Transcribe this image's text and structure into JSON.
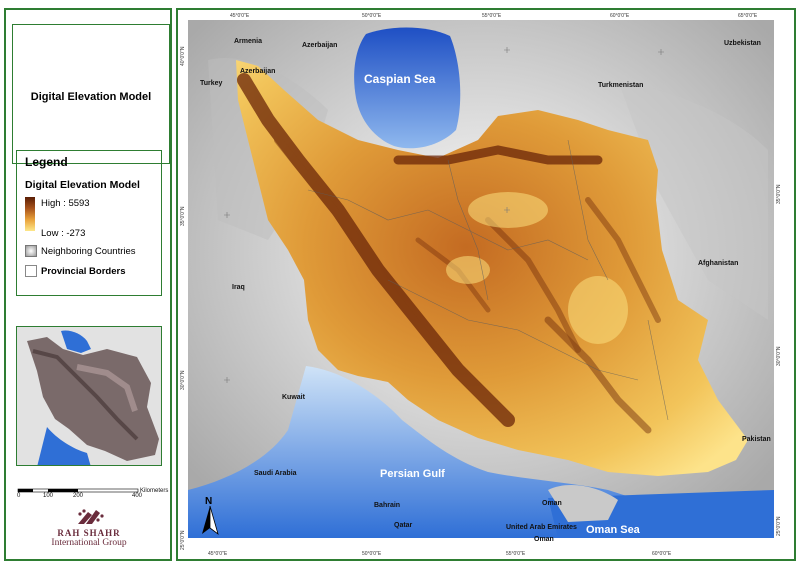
{
  "title": "Digital Elevation Model",
  "legend": {
    "title": "Legend",
    "subtitle": "Digital Elevation Model",
    "high_label": "High : 5593",
    "low_label": "Low : -273",
    "neighboring": "Neighboring Countries",
    "provincial": "Provincial Borders",
    "colors": {
      "high": "#5a1d05",
      "mid": "#e9a23b",
      "low": "#fde78a",
      "water": "#2f6fd6"
    }
  },
  "scale": {
    "ticks": [
      "0",
      "100",
      "200",
      "400"
    ],
    "unit": "Kilometers"
  },
  "logo": {
    "name": "RAH SHAHR",
    "sub": "International Group"
  },
  "north_symbol": "N",
  "map_labels": {
    "caspian": "Caspian Sea",
    "persian_gulf": "Persian Gulf",
    "oman_sea": "Oman Sea",
    "armenia": "Armenia",
    "azerbaijan_north": "Azerbaijan",
    "azerbaijan_west": "Azerbaijan",
    "turkey": "Turkey",
    "uzbekistan": "Uzbekistan",
    "turkmenistan": "Turkmenistan",
    "iraq": "Iraq",
    "afghanistan": "Afghanistan",
    "kuwait": "Kuwait",
    "saudi_arabia": "Saudi Arabia",
    "bahrain": "Bahrain",
    "qatar": "Qatar",
    "uae": "United Arab Emirates",
    "oman_north": "Oman",
    "oman_south": "Oman",
    "pakistan": "Pakistan"
  },
  "coords": {
    "top": [
      "45°0'0\"E",
      "50°0'0\"E",
      "55°0'0\"E",
      "60°0'0\"E",
      "65°0'0\"E"
    ],
    "bottom": [
      "45°0'0\"E",
      "50°0'0\"E",
      "55°0'0\"E",
      "60°0'0\"E"
    ],
    "left": [
      "40°0'0\"N",
      "35°0'0\"N",
      "30°0'0\"N",
      "25°0'0\"N"
    ],
    "right": [
      "35°0'0\"N",
      "30°0'0\"N",
      "25°0'0\"N"
    ]
  }
}
